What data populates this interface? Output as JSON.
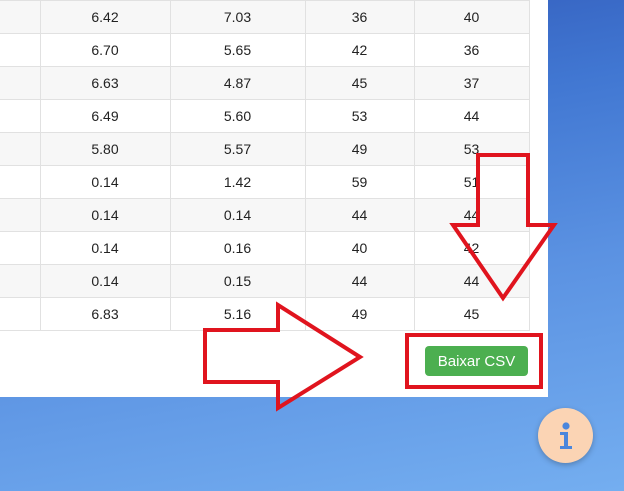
{
  "table": {
    "rows": [
      [
        "",
        "6.42",
        "7.03",
        "36",
        "40"
      ],
      [
        "",
        "6.70",
        "5.65",
        "42",
        "36"
      ],
      [
        "",
        "6.63",
        "4.87",
        "45",
        "37"
      ],
      [
        "",
        "6.49",
        "5.60",
        "53",
        "44"
      ],
      [
        "",
        "5.80",
        "5.57",
        "49",
        "53"
      ],
      [
        "",
        "0.14",
        "1.42",
        "59",
        "51"
      ],
      [
        "",
        "0.14",
        "0.14",
        "44",
        "44"
      ],
      [
        "",
        "0.14",
        "0.16",
        "40",
        "42"
      ],
      [
        "",
        "0.14",
        "0.15",
        "44",
        "44"
      ],
      [
        "",
        "6.83",
        "5.16",
        "49",
        "45"
      ]
    ]
  },
  "download_button": {
    "label": "Baixar CSV",
    "color": "#4caf50"
  },
  "annotations": {
    "color": "#e0141e",
    "arrow_right_icon": "arrow-right-outline",
    "arrow_down_icon": "arrow-down-outline"
  },
  "info_button": {
    "icon": "info-icon",
    "background": "#fbd4b4",
    "icon_color": "#4a86dc"
  }
}
